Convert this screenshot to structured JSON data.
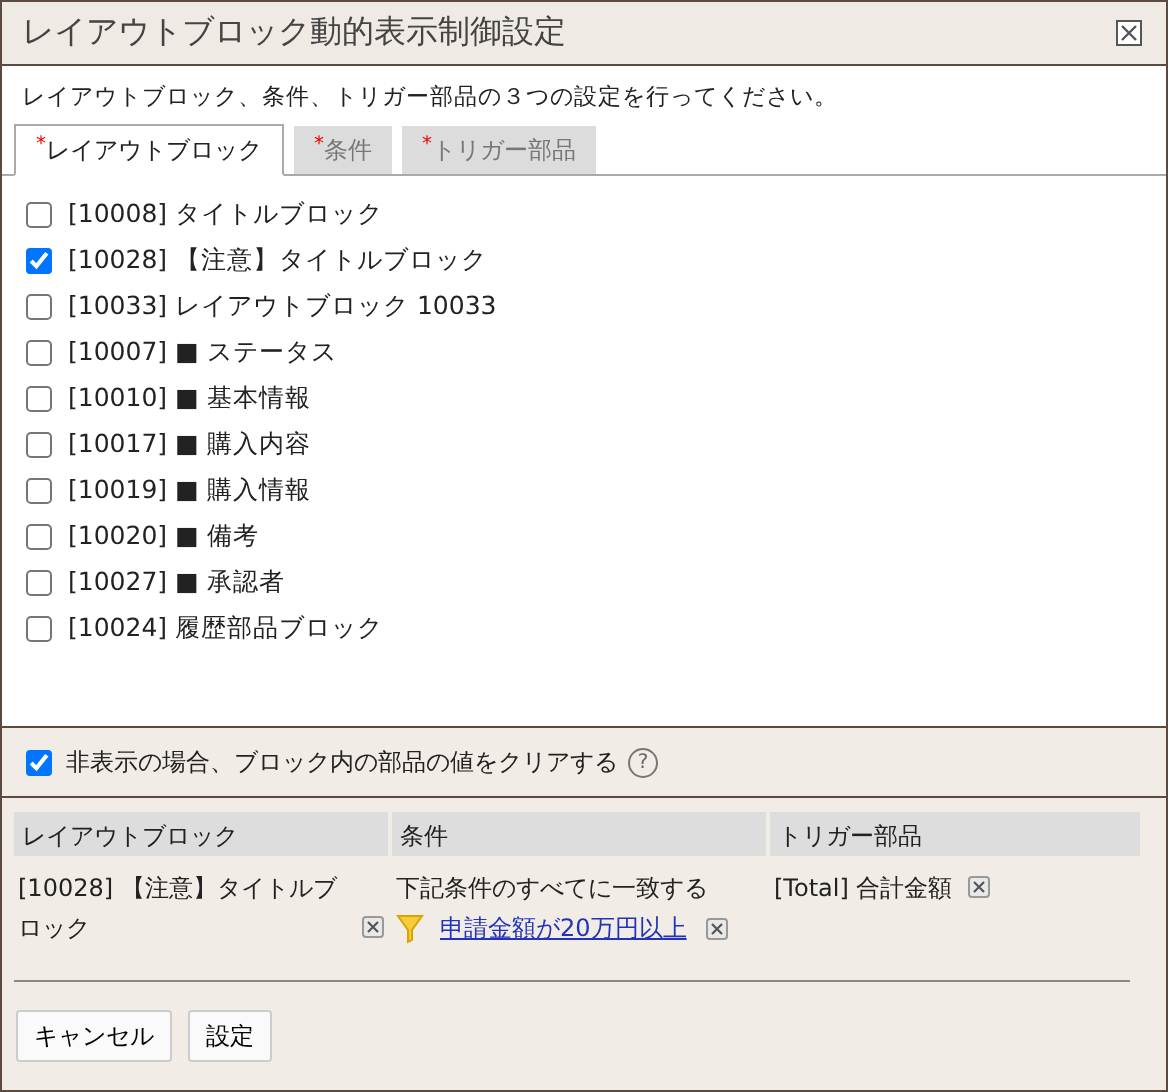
{
  "window": {
    "title": "レイアウトブロック動的表示制御設定"
  },
  "instruction": "レイアウトブロック、条件、トリガー部品の３つの設定を行ってください。",
  "tabs": [
    {
      "required_mark": "*",
      "label": "レイアウトブロック",
      "selected": true
    },
    {
      "required_mark": "*",
      "label": "条件",
      "selected": false
    },
    {
      "required_mark": "*",
      "label": "トリガー部品",
      "selected": false
    }
  ],
  "blocks": [
    {
      "label": "[10008] タイトルブロック",
      "checked": false
    },
    {
      "label": "[10028] 【注意】タイトルブロック",
      "checked": true
    },
    {
      "label": "[10033] レイアウトブロック 10033",
      "checked": false
    },
    {
      "label": "[10007] ■ ステータス",
      "checked": false
    },
    {
      "label": "[10010] ■ 基本情報",
      "checked": false
    },
    {
      "label": "[10017] ■ 購入内容",
      "checked": false
    },
    {
      "label": "[10019] ■ 購入情報",
      "checked": false
    },
    {
      "label": "[10020] ■ 備考",
      "checked": false
    },
    {
      "label": "[10027] ■ 承認者",
      "checked": false
    },
    {
      "label": "[10024] 履歴部品ブロック",
      "checked": false
    }
  ],
  "clear_option": {
    "label": "非表示の場合、ブロック内の部品の値をクリアする",
    "checked": true,
    "help": "?"
  },
  "table": {
    "columns": [
      "レイアウトブロック",
      "条件",
      "トリガー部品"
    ],
    "rows": [
      {
        "block": "[10028] 【注意】タイトルブロック",
        "condition": "下記条件のすべてに一致する",
        "condition_link": "申請金額が20万円以上",
        "trigger": "[Total] 合計金額"
      }
    ]
  },
  "buttons": [
    "キャンセル",
    "設定"
  ]
}
